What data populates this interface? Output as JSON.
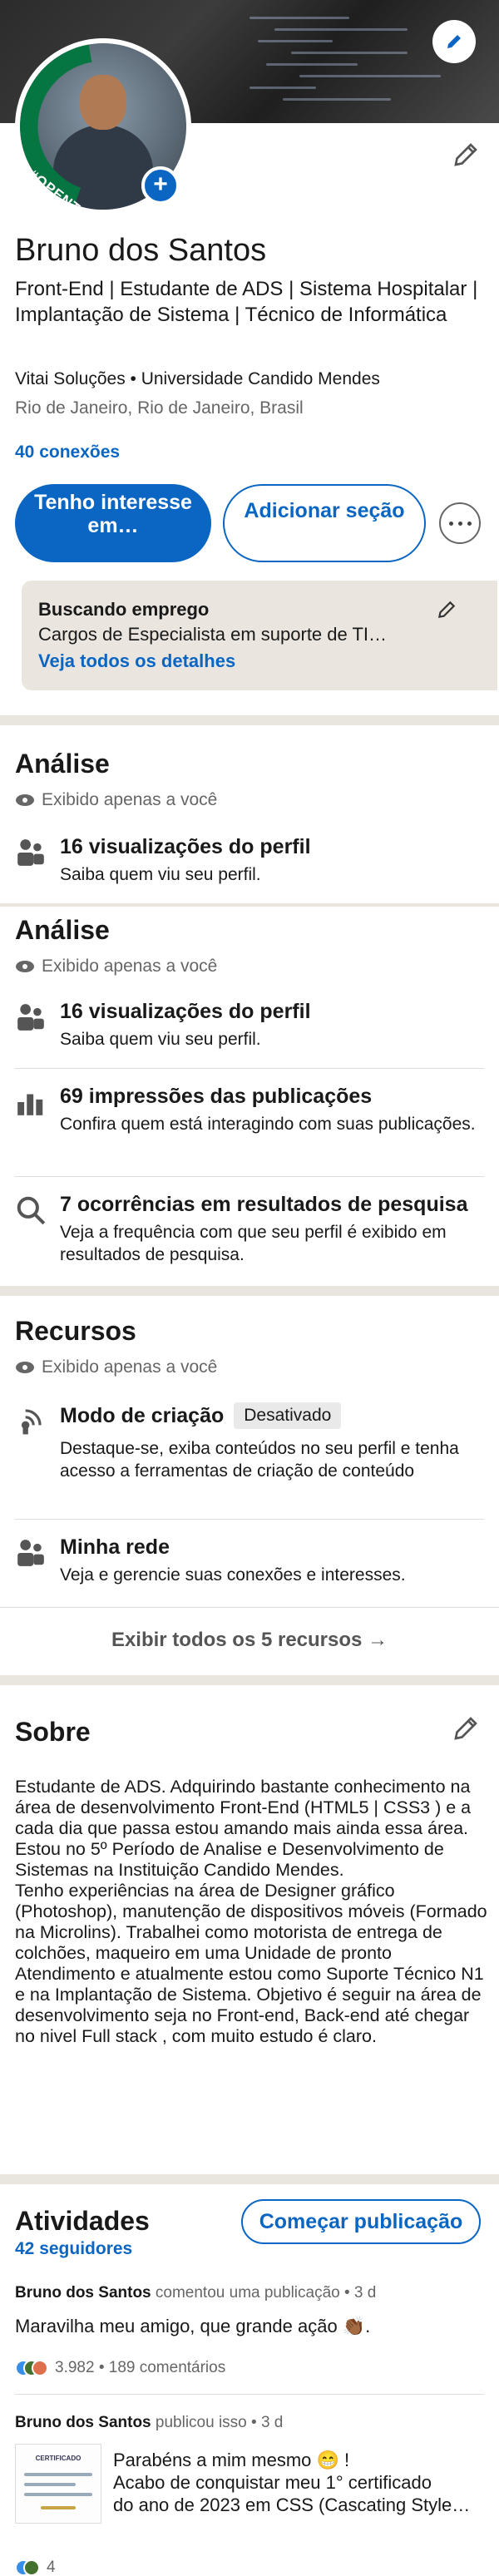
{
  "profile": {
    "name": "Bruno dos Santos",
    "headline": "Front-End | Estudante de ADS | Sistema Hospitalar | Implantação de Sistema | Técnico de Informática",
    "company_education": "Vitai Soluções • Universidade Candido Mendes",
    "location": "Rio de Janeiro, Rio de Janeiro, Brasil",
    "connections": "40 conexões",
    "open_to_work_frame": "#OPENTOWORK",
    "btn_interest": "Tenho interesse em…",
    "btn_add_section": "Adicionar seção",
    "open_to_work": {
      "title": "Buscando emprego",
      "description": "Cargos de Especialista em suporte de TI…",
      "link": "Veja todos os detalhes"
    }
  },
  "analytics_1": {
    "title": "Análise",
    "private": "Exibido apenas a você",
    "items": [
      {
        "title": "16 visualizações do perfil",
        "desc": "Saiba quem viu seu perfil."
      }
    ]
  },
  "analytics_2": {
    "title": "Análise",
    "private": "Exibido apenas a você",
    "items": [
      {
        "title": "16 visualizações do perfil",
        "desc": "Saiba quem viu seu perfil."
      },
      {
        "title": "69 impressões das publicações",
        "desc": "Confira quem está interagindo com suas publicações."
      },
      {
        "title": "7 ocorrências em resultados de pesquisa",
        "desc": "Veja a frequência com que seu perfil é exibido em resultados de pesquisa."
      }
    ]
  },
  "resources": {
    "title": "Recursos",
    "private": "Exibido apenas a você",
    "items": [
      {
        "title": "Modo de criação",
        "badge": "Desativado",
        "desc": "Destaque-se, exiba conteúdos no seu perfil e tenha acesso a ferramentas de criação de conteúdo"
      },
      {
        "title": "Minha rede",
        "desc": "Veja e gerencie suas conexões e interesses."
      }
    ],
    "show_all": "Exibir todos os 5 recursos →"
  },
  "about": {
    "title": "Sobre",
    "text": "Estudante de ADS. Adquirindo bastante conhecimento na área de desenvolvimento Front-End (HTML5 | CSS3 ) e a cada dia que passa estou amando mais ainda essa área. Estou no 5º Período de Analise e Desenvolvimento de Sistemas na Instituição Candido Mendes.\nTenho experiências na área de Designer gráfico (Photoshop), manutenção de dispositivos móveis (Formado na Microlins). Trabalhei como motorista de entrega de colchões, maqueiro em uma Unidade de pronto Atendimento e atualmente estou como Suporte Técnico N1 e na Implantação de Sistema. Objetivo é seguir na área de desenvolvimento seja no Front-end, Back-end até chegar no nivel Full stack , com muito estudo é claro."
  },
  "activity": {
    "title": "Atividades",
    "followers": "42 seguidores",
    "btn_post": "Começar publicação",
    "posts": [
      {
        "author": "Bruno dos Santos",
        "action": "comentou uma publicação • 3 d",
        "text": "Maravilha meu amigo, que grande ação 👏🏾.",
        "reactions": "3.982 • 189 comentários"
      },
      {
        "author": "Bruno dos Santos",
        "action": "publicou isso • 3 d",
        "thumb_label": "CERTIFICADO",
        "line1": "Parabéns a mim mesmo 😁 !",
        "line2": "Acabo de conquistar meu 1° certificado",
        "line3": "do ano de 2023 em CSS (Cascating Style…",
        "reactions": "4"
      }
    ]
  },
  "colors": {
    "accent": "#0a66c2",
    "open_to_work": "#057642",
    "page_bg": "#f4f2ee"
  }
}
